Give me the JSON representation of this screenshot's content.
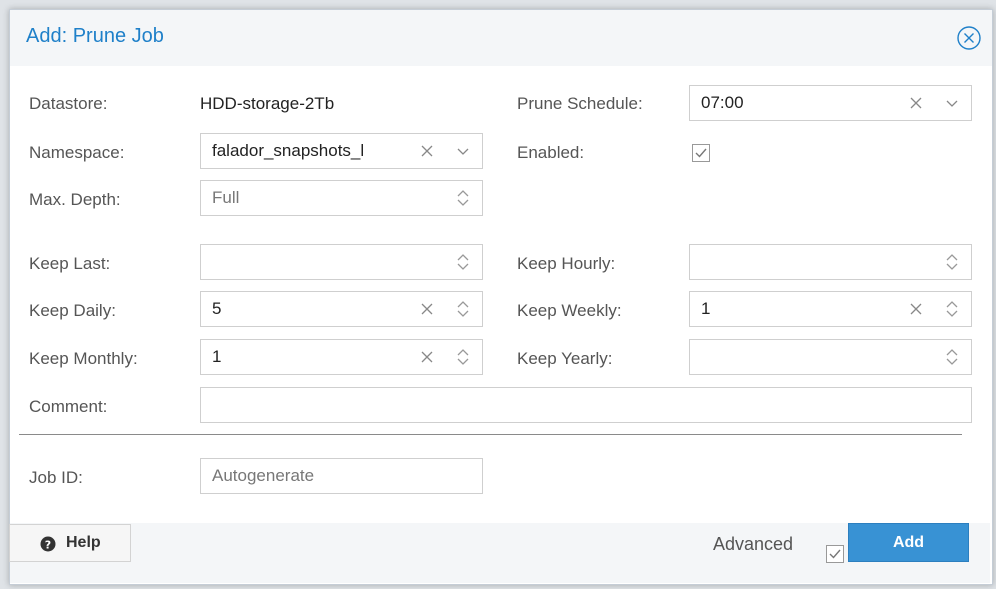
{
  "dialog": {
    "title": "Add: Prune Job"
  },
  "fields": {
    "datastore": {
      "label": "Datastore:",
      "value": "HDD-storage-2Tb"
    },
    "namespace": {
      "label": "Namespace:",
      "value": "falador_snapshots_l"
    },
    "max_depth": {
      "label": "Max. Depth:",
      "value": "Full"
    },
    "prune_schedule": {
      "label": "Prune Schedule:",
      "value": "07:00"
    },
    "enabled": {
      "label": "Enabled:",
      "checked": true
    },
    "keep_last": {
      "label": "Keep Last:",
      "value": ""
    },
    "keep_hourly": {
      "label": "Keep Hourly:",
      "value": ""
    },
    "keep_daily": {
      "label": "Keep Daily:",
      "value": "5"
    },
    "keep_weekly": {
      "label": "Keep Weekly:",
      "value": "1"
    },
    "keep_monthly": {
      "label": "Keep Monthly:",
      "value": "1"
    },
    "keep_yearly": {
      "label": "Keep Yearly:",
      "value": ""
    },
    "comment": {
      "label": "Comment:",
      "value": ""
    },
    "job_id": {
      "label": "Job ID:",
      "value": "Autogenerate"
    }
  },
  "footer": {
    "help_label": "Help",
    "advanced_label": "Advanced",
    "advanced_checked": true,
    "add_label": "Add"
  },
  "colors": {
    "title": "#1f80c9",
    "primary_button": "#3892d4"
  }
}
